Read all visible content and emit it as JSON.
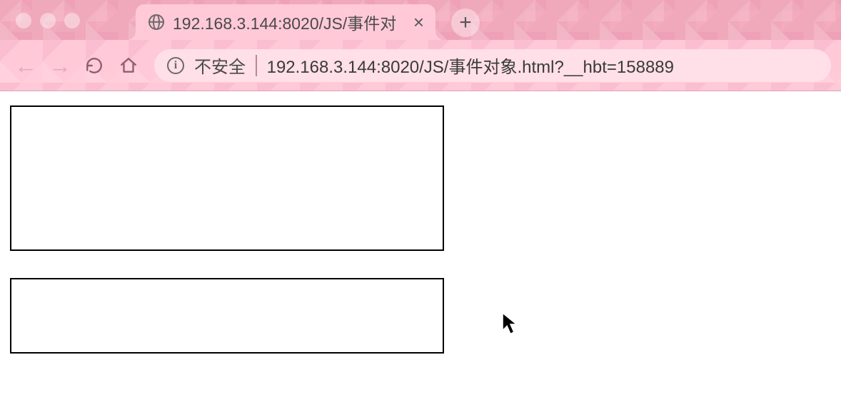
{
  "browser": {
    "tab": {
      "title": "192.168.3.144:8020/JS/事件对"
    },
    "address_bar": {
      "insecure_label": "不安全",
      "url": "192.168.3.144:8020/JS/事件对象.html?__hbt=158889"
    }
  },
  "page": {
    "textarea_value": "",
    "input_value": ""
  }
}
